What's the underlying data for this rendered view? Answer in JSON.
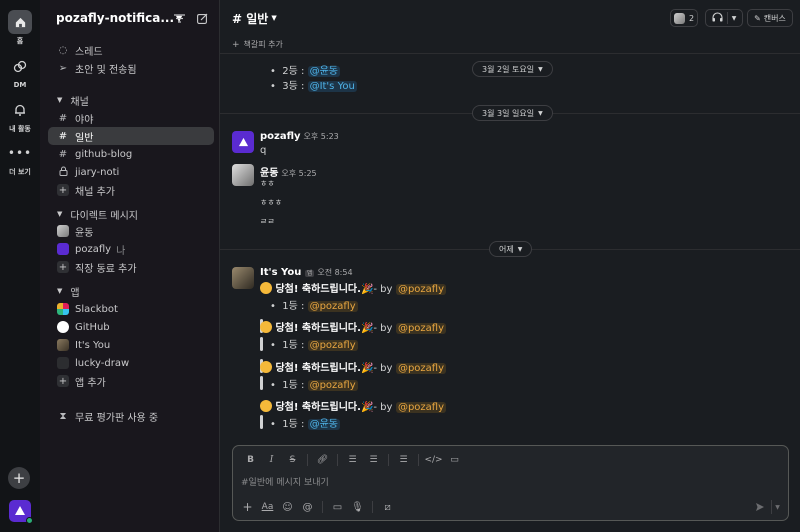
{
  "rail": {
    "home_label": "홈",
    "dm_label": "DM",
    "activity_label": "내 활동",
    "more_label": "더 보기"
  },
  "sidebar": {
    "workspace_name": "pozafly-notifica...",
    "threads": "스레드",
    "drafts": "초안 및 전송됨",
    "channels_section": "채널",
    "channels": [
      "야야",
      "일반",
      "github-blog",
      "jiary-noti"
    ],
    "add_channel": "채널 추가",
    "dm_section": "다이렉트 메시지",
    "dms": [
      {
        "name": "윤동",
        "suffix": ""
      },
      {
        "name": "pozafly",
        "suffix": "나"
      }
    ],
    "add_coworker": "직장 동료 추가",
    "apps_section": "앱",
    "apps": [
      "Slackbot",
      "GitHub",
      "It's You",
      "lucky-draw"
    ],
    "add_app": "앱 추가",
    "trial": "무료 평가판 사용 중"
  },
  "header": {
    "channel_title": "# 일반",
    "member_count": "2",
    "canvas_label": "캔버스",
    "bookmark_add": "책갈피 추가"
  },
  "messages": {
    "prev_line1_prefix": "2등 : ",
    "prev_line1_mention": "@윤동",
    "prev_line2_prefix": "3등 : ",
    "prev_line2_mention": "@It's You",
    "date1": "3월 2일 토요일",
    "date2": "3월 3일 일요일",
    "date3": "어제",
    "m1_sender": "pozafly",
    "m1_time": "오후 5:23",
    "m1_text": "q",
    "m2_sender": "윤동",
    "m2_time": "오후 5:25",
    "m2_lines": [
      "ㅎㅎ",
      "ㅎㅎㅎ",
      "ㄹㄹ"
    ],
    "m3_sender": "It's You",
    "m3_badge": "앱",
    "m3_time": "오전 8:54",
    "win_text": "당첨! 축하드립니다.",
    "by_text": "- by",
    "by_mention": "@pozafly",
    "rank_prefix": "1등 : ",
    "winners": [
      "@pozafly",
      "@pozafly",
      "@pozafly",
      "@윤동"
    ]
  },
  "composer": {
    "placeholder": "#일반에 메시지 보내기"
  },
  "colors": {
    "brand": "#5a2bd1",
    "mention_bg": "#3b3220",
    "mention_fg": "#e8a640",
    "mention_blue_fg": "#4fb3e8"
  }
}
